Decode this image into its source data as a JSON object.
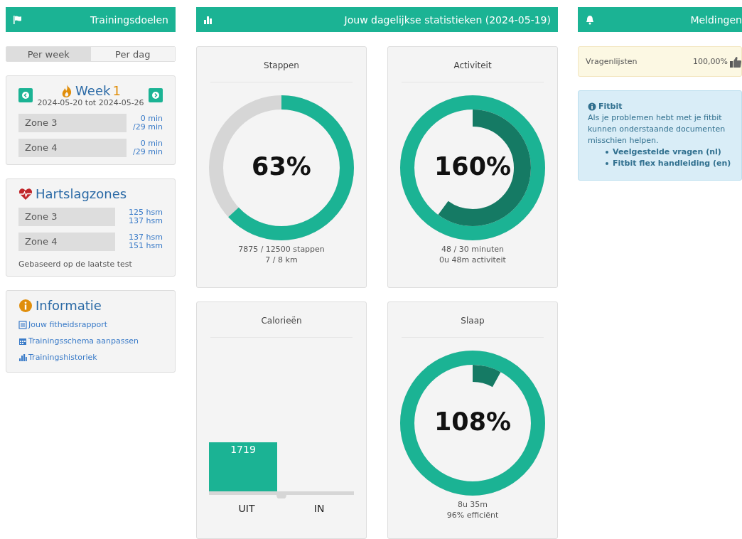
{
  "left": {
    "header": {
      "title": "Trainingsdoelen"
    },
    "tabs": [
      {
        "label": "Per week",
        "selected": true
      },
      {
        "label": "Per dag",
        "selected": false
      }
    ],
    "week": {
      "title": "Week",
      "number": "1",
      "range": "2024-05-20 tot 2024-05-26",
      "zones": [
        {
          "name": "Zone 3",
          "line1": "0 min",
          "line2": "/29 min"
        },
        {
          "name": "Zone 4",
          "line1": "0 min",
          "line2": "/29 min"
        }
      ]
    },
    "heart": {
      "title": "Hartslagzones",
      "zones": [
        {
          "name": "Zone 3",
          "line1": "125 hsm",
          "line2": "137 hsm"
        },
        {
          "name": "Zone 4",
          "line1": "137 hsm",
          "line2": "151 hsm"
        }
      ],
      "note": "Gebaseerd op de laatste test"
    },
    "info": {
      "title": "Informatie",
      "links": [
        {
          "kind": "report",
          "label": "Jouw fitheidsrapport"
        },
        {
          "kind": "calendar",
          "label": "Trainingsschema aanpassen"
        },
        {
          "kind": "history",
          "label": "Trainingshistoriek"
        }
      ]
    }
  },
  "middle": {
    "header": {
      "title": "Jouw dagelijkse statistieken (2024-05-19)"
    },
    "cards": [
      {
        "kind": "ring",
        "title": "Stappen",
        "percent": "63%",
        "lines": [
          "7875 / 12500 stappen",
          "7 / 8 km"
        ]
      },
      {
        "kind": "ring",
        "title": "Activiteit",
        "percent": "160%",
        "lines": [
          "48 / 30 minuten",
          "0u 48m activiteit"
        ]
      },
      {
        "kind": "bar",
        "title": "Calorieën",
        "chart_data": {
          "type": "bar",
          "categories": [
            "UIT",
            "IN"
          ],
          "values": [
            1719,
            0
          ],
          "value_labels": [
            "1719",
            null
          ]
        }
      },
      {
        "kind": "ring",
        "title": "Slaap",
        "percent": "108%",
        "lines": [
          "8u 35m",
          "96% efficiënt"
        ]
      }
    ]
  },
  "right": {
    "header": {
      "title": "Meldingen"
    },
    "alert": {
      "label": "Vragenlijsten",
      "value": "100,00%"
    },
    "fitbit": {
      "title": "Fitbit",
      "text": "Als je problemen hebt met je fitbit kunnen onderstaande documenten misschien helpen.",
      "links": [
        "Veelgestelde vragen (nl)",
        "Fitbit flex handleiding (en)"
      ]
    }
  }
}
